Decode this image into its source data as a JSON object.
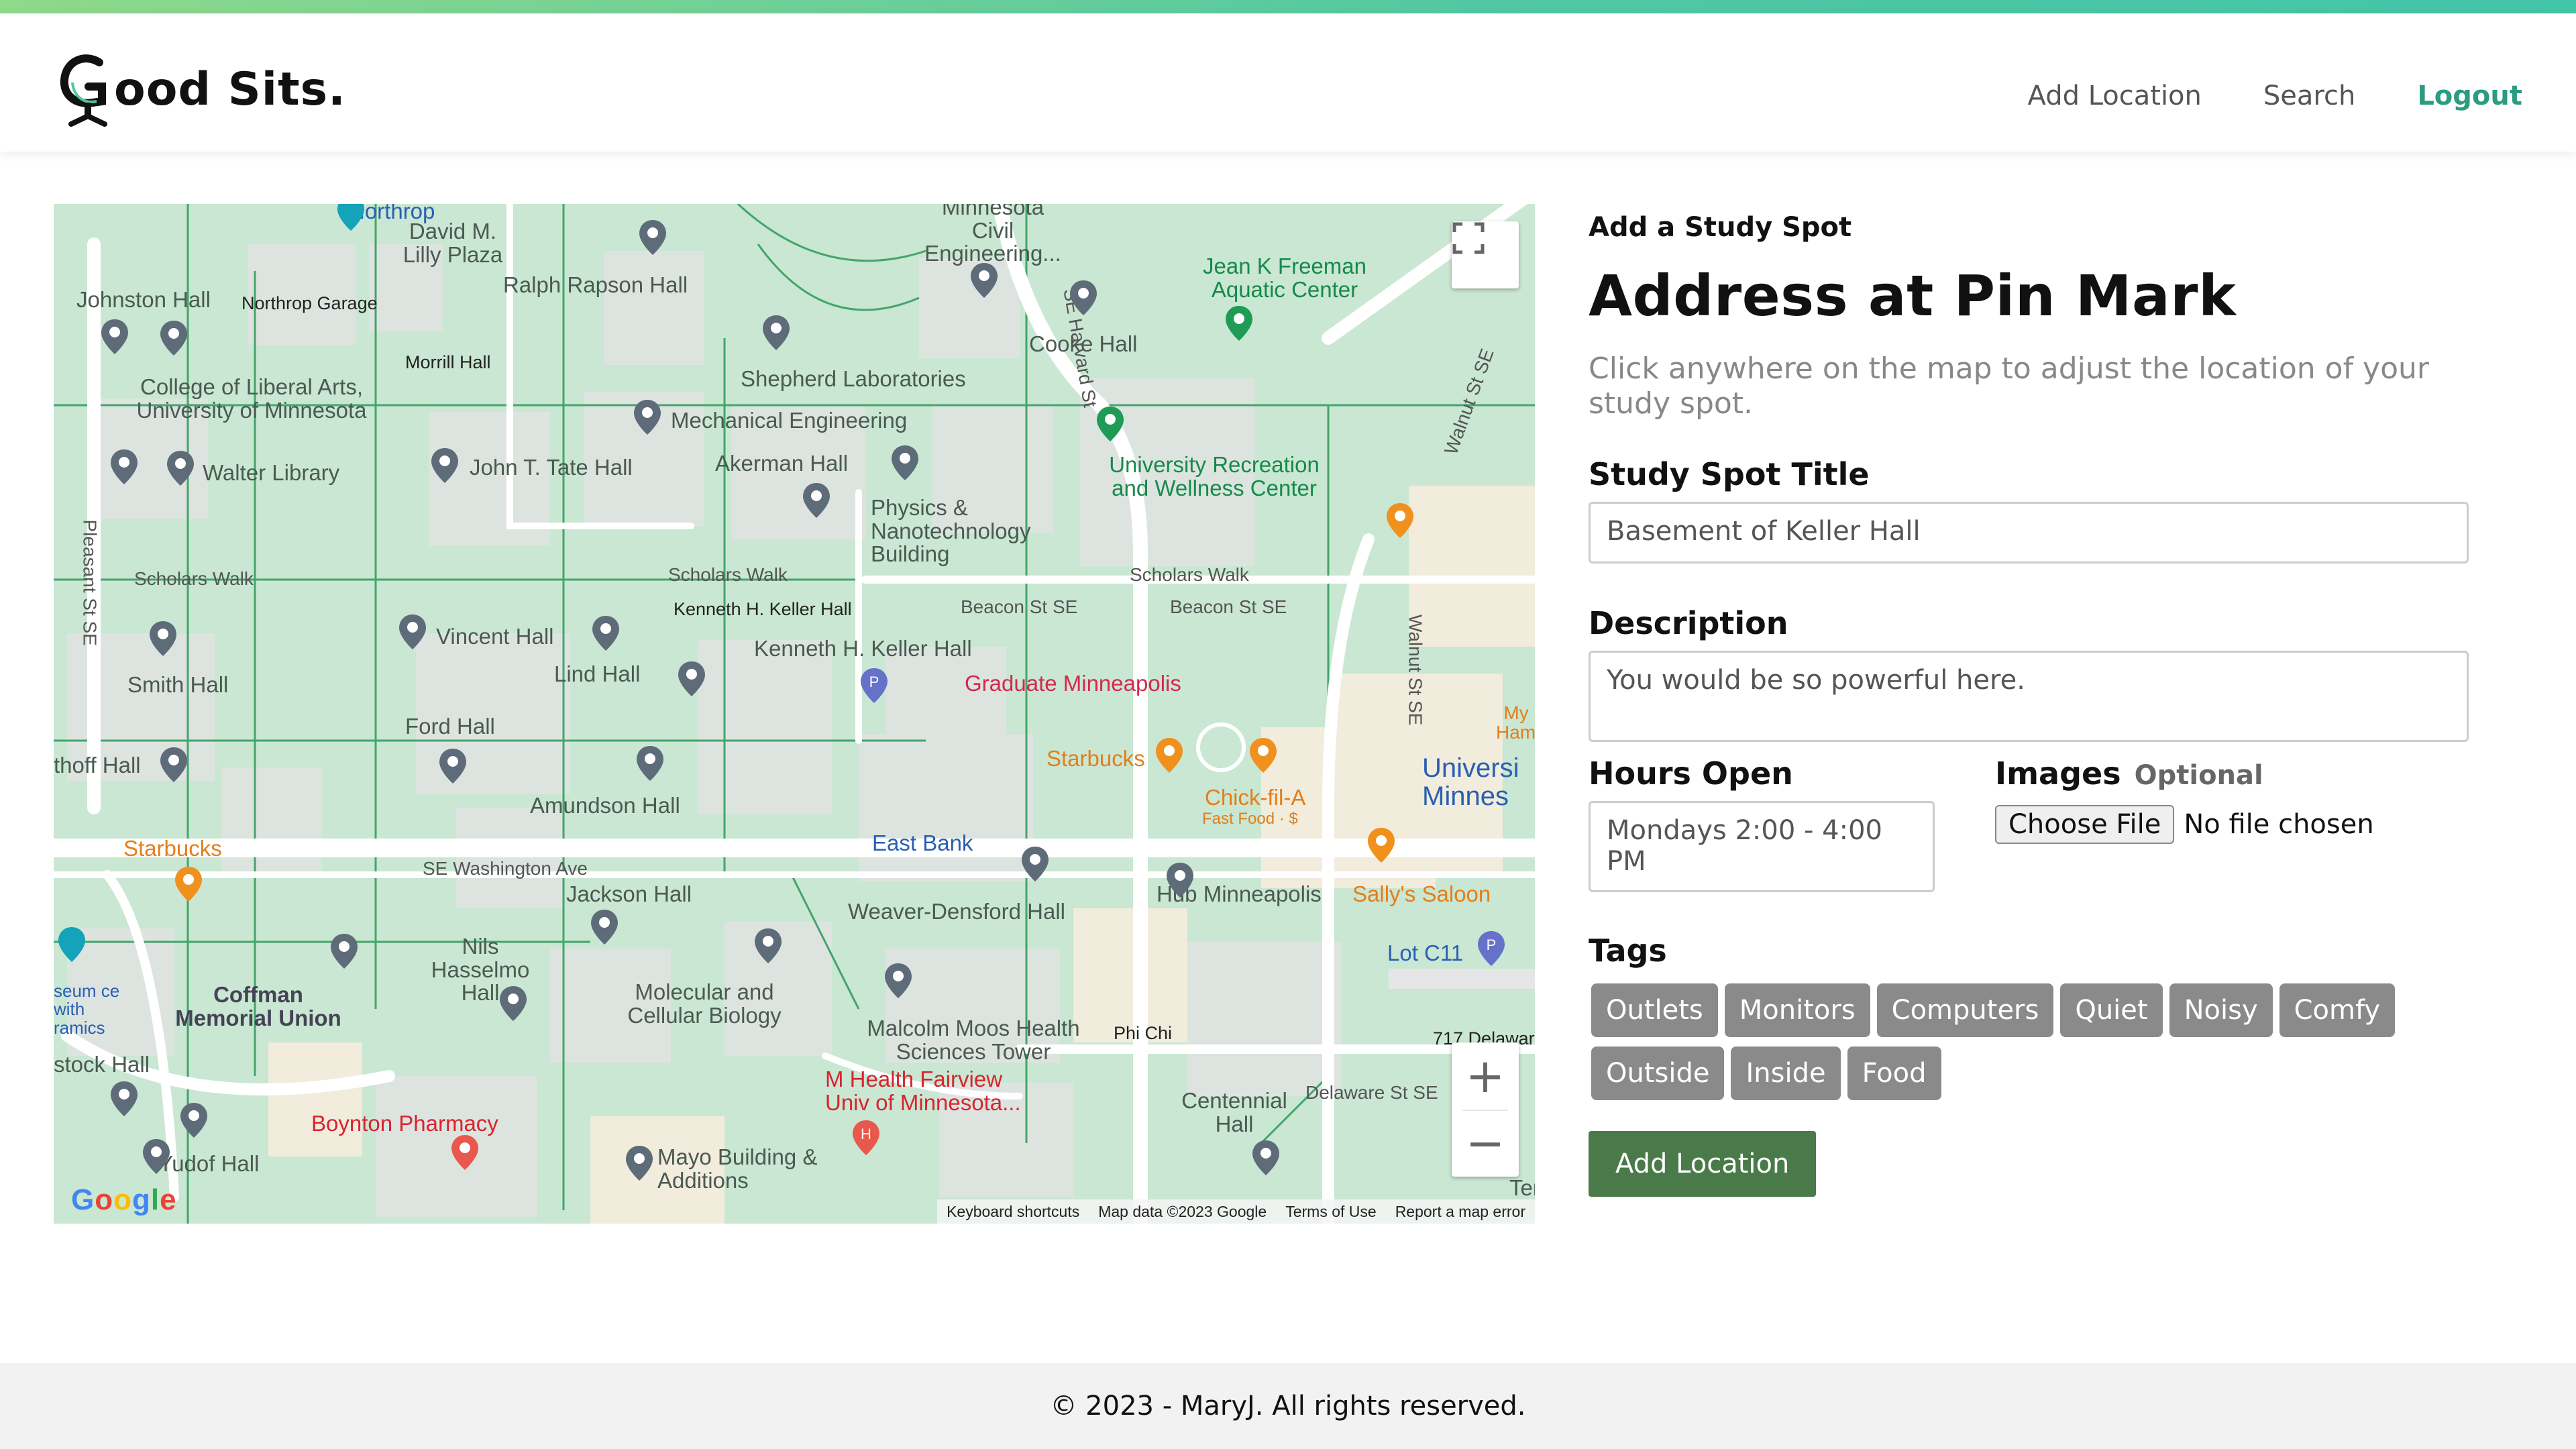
{
  "brand": {
    "name": "ood Sits.",
    "logo_letter": "G"
  },
  "nav": {
    "items": [
      {
        "label": "Add Location"
      },
      {
        "label": "Search"
      },
      {
        "label": "Logout"
      }
    ]
  },
  "map": {
    "labels": {
      "northrop": "Northrop",
      "minnesota_civil": "Minnesota Civil Engineering...",
      "jean_freeman": "Jean K Freeman Aquatic Center",
      "david_lilly": "David M. Lilly Plaza",
      "ralph_rapson": "Ralph Rapson Hall",
      "johnston": "Johnston Hall",
      "northrop_garage": "Northrop Garage",
      "cooke": "Cooke Hall",
      "morrill": "Morrill Hall",
      "shepherd": "Shepherd Laboratories",
      "cla": "College of Liberal Arts, University of Minnesota",
      "mech_eng": "Mechanical Engineering",
      "recwell": "University Recreation and Wellness Center",
      "walter": "Walter Library",
      "tate": "John T. Tate Hall",
      "akerman": "Akerman Hall",
      "physics": "Physics & Nanotechnology Building",
      "scholars_walk_1": "Scholars Walk",
      "scholars_walk_2": "Scholars Walk",
      "scholars_walk_3": "Scholars Walk",
      "keller_small": "Kenneth H. Keller Hall",
      "beacon_1": "Beacon St SE",
      "beacon_2": "Beacon St SE",
      "vincent": "Vincent Hall",
      "smith": "Smith Hall",
      "lind": "Lind Hall",
      "keller": "Kenneth H. Keller Hall",
      "grad_mpls": "Graduate Minneapolis",
      "ford": "Ford Hall",
      "starbucks_1": "Starbucks",
      "thoff": "thoff Hall",
      "amundson": "Amundson Hall",
      "chickfila": "Chick-fil-A",
      "fastfood": "Fast Food · $",
      "university_minn": "Universi Minnes",
      "starbucks_2": "Starbucks",
      "wash_ave": "SE Washington Ave",
      "east_bank": "East Bank",
      "jackson": "Jackson Hall",
      "weaver": "Weaver-Densford Hall",
      "hub": "Hub Minneapolis",
      "sallys": "Sally's Saloon",
      "nils": "Nils Hasselmo Hall",
      "lot_c11": "Lot C11",
      "seum": "seum ce with ramics",
      "coffman": "Coffman Memorial Union",
      "molecular": "Molecular and Cellular Biology",
      "malcolm": "Malcolm Moos Health Sciences Tower",
      "phichi": "Phi Chi",
      "delaware_717": "717 Delawar",
      "stock": "stock Hall",
      "mhealth": "M Health Fairview Univ of Minnesota...",
      "centennial": "Centennial Hall",
      "delaware": "Delaware St SE",
      "boynton": "Boynton Pharmacy",
      "yudof": "Yudof Hall",
      "mayo": "Mayo Building & Additions",
      "pleasant": "Pleasant St SE",
      "harvard": "SE Harvard St",
      "walnut_1": "Walnut St SE",
      "walnut_2": "Walnut St SE",
      "my_haml": "My Haml",
      "ter": "Ter"
    },
    "attribution": {
      "shortcuts": "Keyboard shortcuts",
      "data": "Map data ©2023 Google",
      "terms": "Terms of Use",
      "report": "Report a map error"
    },
    "google": "Google",
    "zoom_in": "+",
    "zoom_out": "−"
  },
  "form": {
    "eyebrow": "Add a Study Spot",
    "title": "Address at Pin Mark",
    "subtitle": "Click anywhere on the map to adjust the location of your study spot.",
    "title_label": "Study Spot Title",
    "title_value": "Basement of Keller Hall",
    "desc_label": "Description",
    "desc_value": "You would be so powerful here.",
    "hours_label": "Hours Open",
    "hours_value": "Mondays 2:00 - 4:00 PM",
    "images_label": "Images",
    "images_optional": "Optional",
    "file_button": "Choose File",
    "file_status": "No file chosen",
    "tags_label": "Tags",
    "tags": [
      "Outlets",
      "Monitors",
      "Computers",
      "Quiet",
      "Noisy",
      "Comfy",
      "Outside",
      "Inside",
      "Food"
    ],
    "submit": "Add Location"
  },
  "footer": {
    "text": "© 2023 - MaryJ. All rights reserved."
  },
  "colors": {
    "accent": "#2b9c7f",
    "submit": "#4a7a49",
    "tag": "#8a8a8a"
  }
}
